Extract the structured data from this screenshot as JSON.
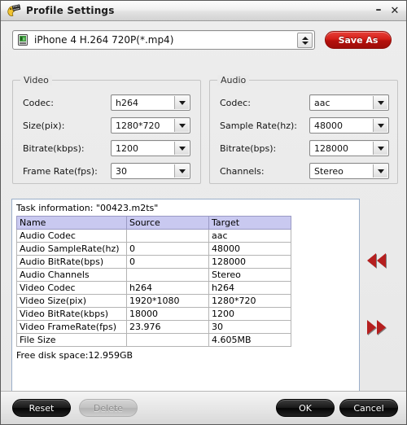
{
  "window": {
    "title": "Profile Settings",
    "app_icon": "profile-settings-icon",
    "minimize_label": "–",
    "close_label": "✕"
  },
  "profile": {
    "icon": "device-profile-icon",
    "selected": "iPhone 4 H.264 720P(*.mp4)",
    "save_as_label": "Save As"
  },
  "video": {
    "legend": "Video",
    "fields": [
      {
        "label": "Codec:",
        "value": "h264"
      },
      {
        "label": "Size(pix):",
        "value": "1280*720"
      },
      {
        "label": "Bitrate(kbps):",
        "value": "1200"
      },
      {
        "label": "Frame Rate(fps):",
        "value": "30"
      }
    ]
  },
  "audio": {
    "legend": "Audio",
    "fields": [
      {
        "label": "Codec:",
        "value": "aac"
      },
      {
        "label": "Sample Rate(hz):",
        "value": "48000"
      },
      {
        "label": "Bitrate(bps):",
        "value": "128000"
      },
      {
        "label": "Channels:",
        "value": "Stereo"
      }
    ]
  },
  "task_info": {
    "title": "Task information: \"00423.m2ts\"",
    "columns": [
      "Name",
      "Source",
      "Target"
    ],
    "rows": [
      {
        "name": "Audio Codec",
        "source": "",
        "target": "aac"
      },
      {
        "name": "Audio SampleRate(hz)",
        "source": "0",
        "target": "48000"
      },
      {
        "name": "Audio BitRate(bps)",
        "source": "0",
        "target": "128000"
      },
      {
        "name": "Audio Channels",
        "source": "",
        "target": "Stereo"
      },
      {
        "name": "Video Codec",
        "source": "h264",
        "target": "h264"
      },
      {
        "name": "Video Size(pix)",
        "source": "1920*1080",
        "target": "1280*720"
      },
      {
        "name": "Video BitRate(kbps)",
        "source": "18000",
        "target": "1200"
      },
      {
        "name": "Video FrameRate(fps)",
        "source": "23.976",
        "target": "30"
      },
      {
        "name": "File Size",
        "source": "",
        "target": "4.605MB"
      }
    ],
    "disk_space": "Free disk space:12.959GB"
  },
  "nav": {
    "prev_icon": "double-arrow-left-icon",
    "next_icon": "double-arrow-right-icon"
  },
  "footer": {
    "reset_label": "Reset",
    "delete_label": "Delete",
    "ok_label": "OK",
    "cancel_label": "Cancel"
  },
  "colors": {
    "accent_red": "#cc1a14",
    "table_header": "#c9c9f0",
    "panel_border": "#9aaec9",
    "window_bg": "#ebebeb"
  }
}
